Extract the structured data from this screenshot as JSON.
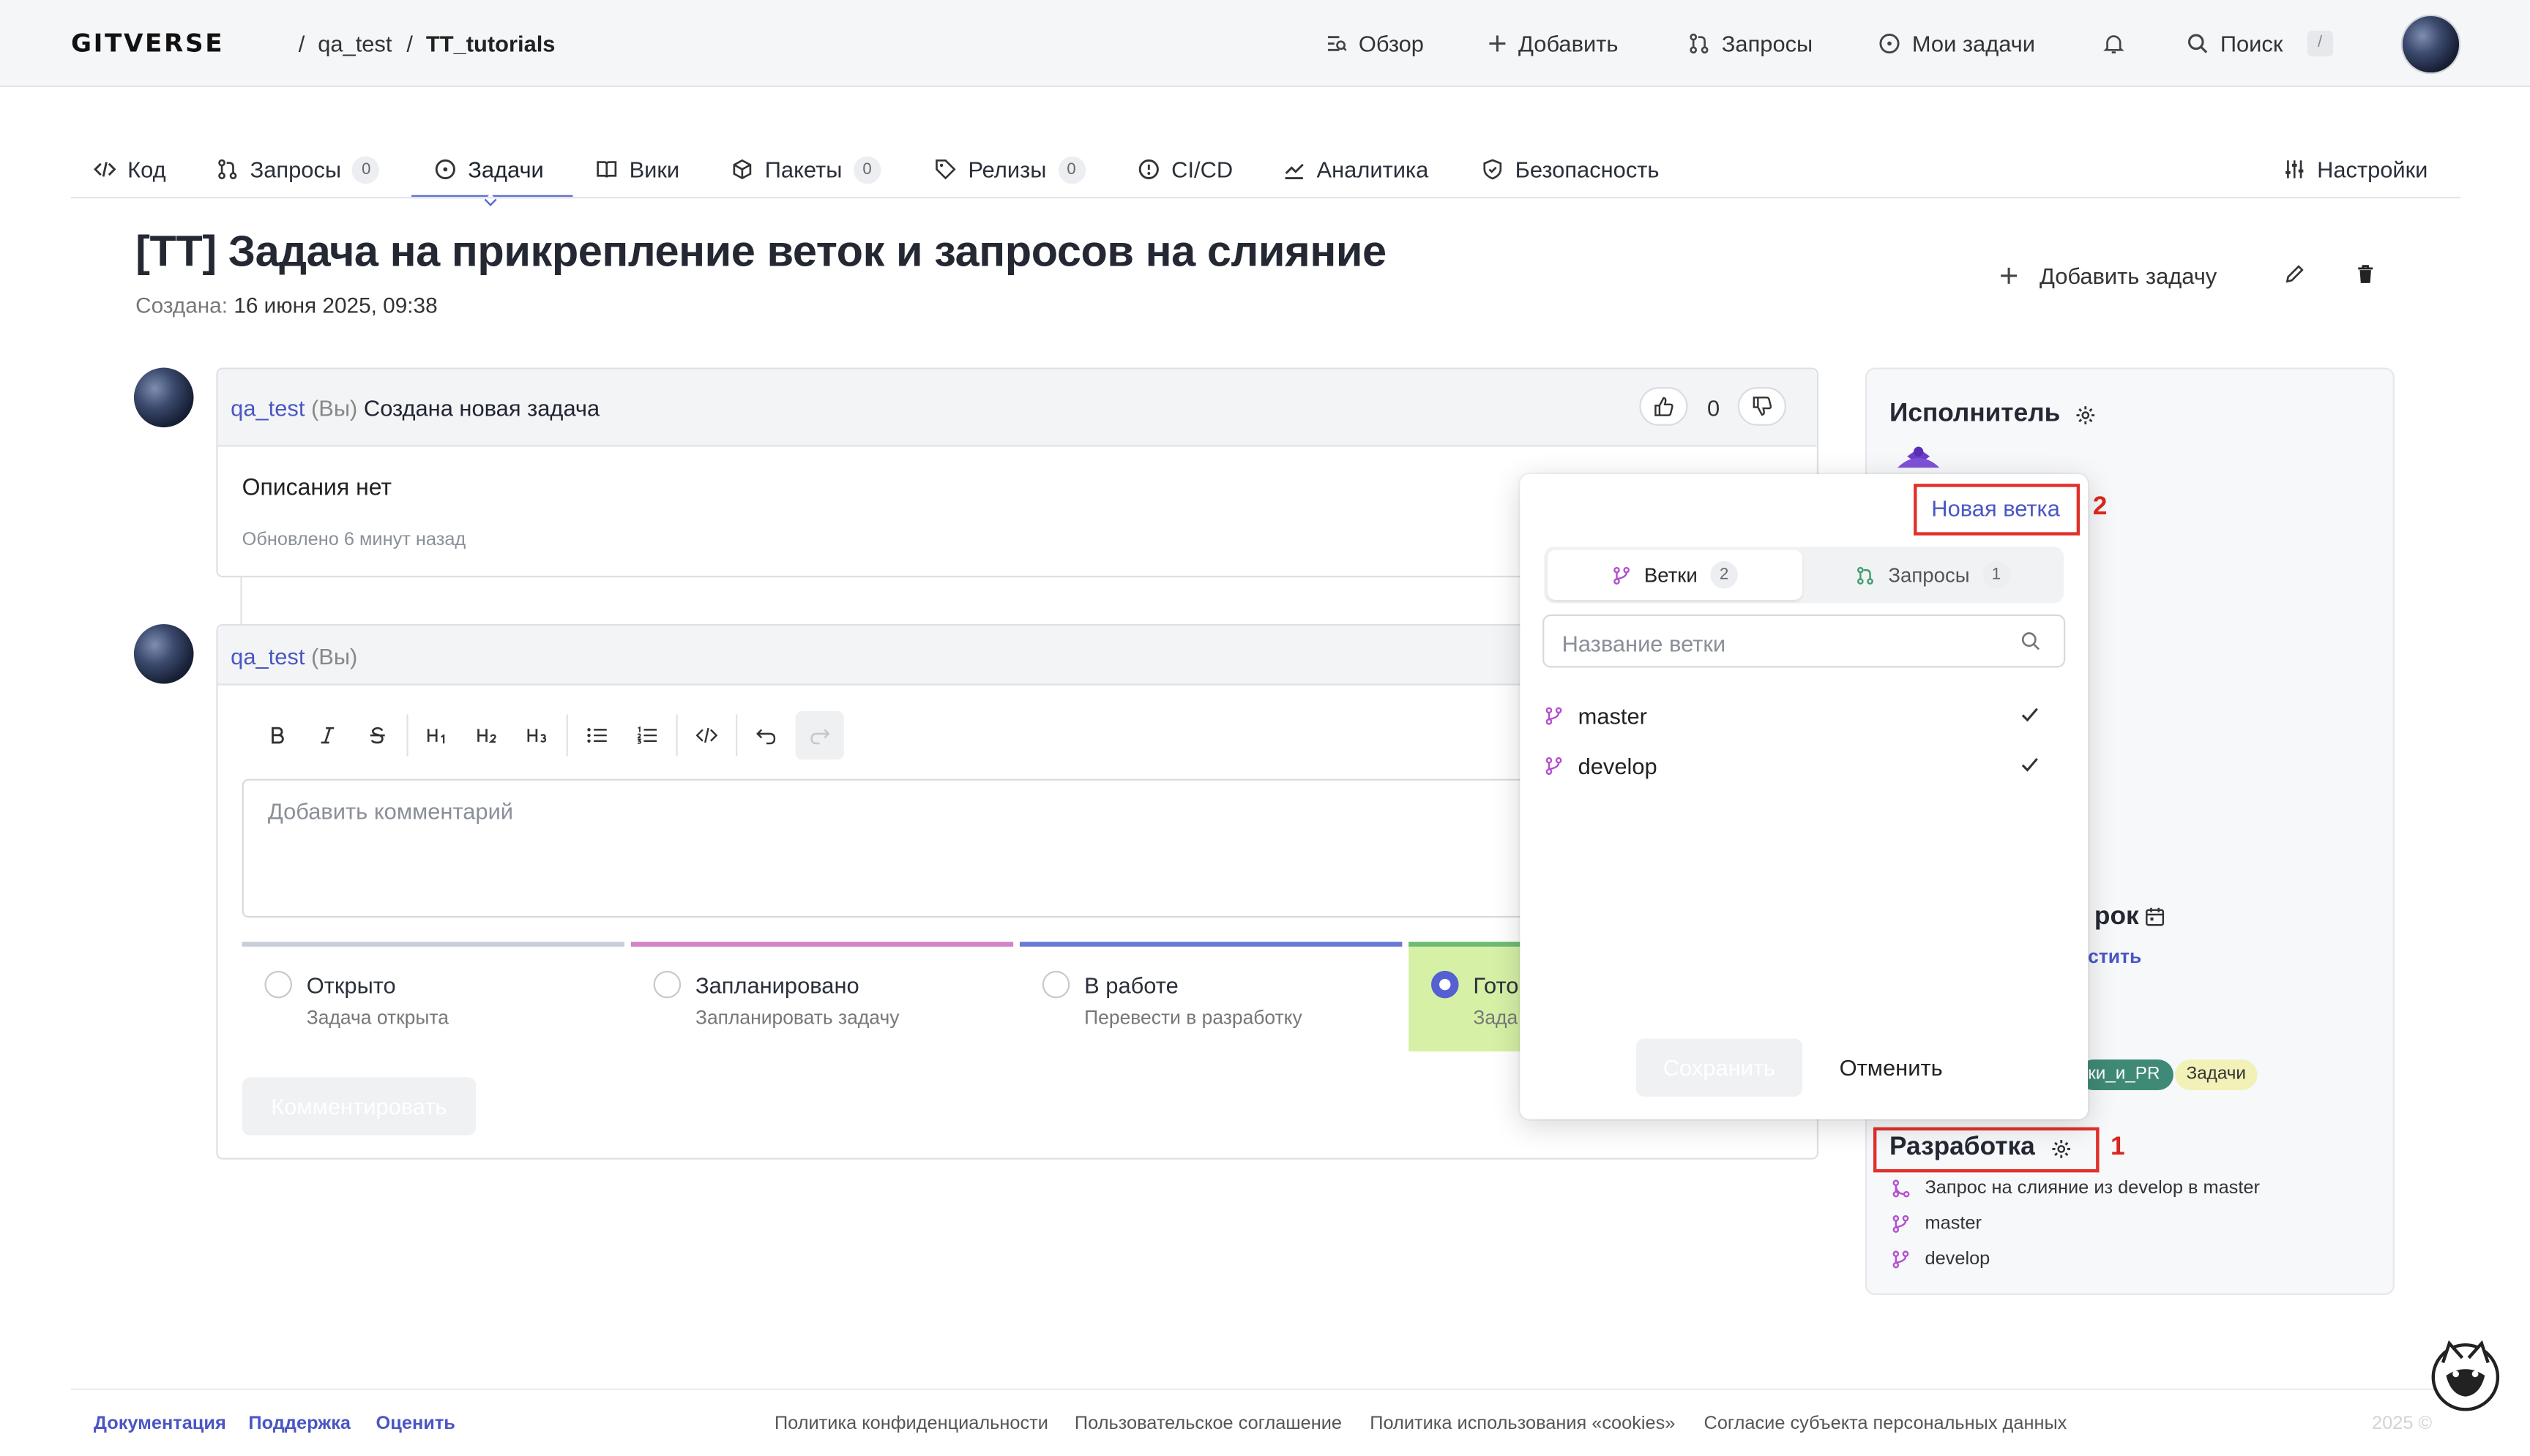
{
  "header": {
    "logo": "GITVERSE",
    "breadcrumb": [
      "qa_test",
      "TT_tutorials"
    ],
    "separator": "/",
    "nav": {
      "overview": "Обзор",
      "add": "Добавить",
      "requests": "Запросы",
      "my_tasks": "Мои задачи",
      "search": "Поиск",
      "search_kbd": "/"
    }
  },
  "tabs": [
    {
      "label": "Код",
      "icon": "code-icon"
    },
    {
      "label": "Запросы",
      "count": "0",
      "icon": "pull-request-icon"
    },
    {
      "label": "Задачи",
      "icon": "issue-icon",
      "active": true
    },
    {
      "label": "Вики",
      "icon": "book-icon"
    },
    {
      "label": "Пакеты",
      "count": "0",
      "icon": "package-icon"
    },
    {
      "label": "Релизы",
      "count": "0",
      "icon": "tag-icon"
    },
    {
      "label": "CI/CD",
      "icon": "pipeline-icon"
    },
    {
      "label": "Аналитика",
      "icon": "chart-icon"
    },
    {
      "label": "Безопасность",
      "icon": "shield-icon"
    },
    {
      "label": "Настройки",
      "icon": "sliders-icon"
    }
  ],
  "issue": {
    "title": "[TT] Задача на прикрепление веток и запросов на слияние",
    "created_label": "Создана:",
    "created_value": "16 июня 2025, 09:38",
    "add_task": "Добавить задачу"
  },
  "comment1": {
    "author": "qa_test",
    "you": "(Вы)",
    "action": "Создана новая задача",
    "body": "Описания нет",
    "updated": "Обновлено 6 минут назад",
    "reactions": "0"
  },
  "comment2": {
    "author": "qa_test",
    "you": "(Вы)",
    "placeholder": "Добавить комментарий",
    "submit": "Комментировать"
  },
  "statuses": [
    {
      "name": "Открыто",
      "desc": "Задача открыта",
      "color": "#c9cfd6"
    },
    {
      "name": "Запланировано",
      "desc": "Запланировать задачу",
      "color": "#d483c8"
    },
    {
      "name": "В работе",
      "desc": "Перевести в разработку",
      "color": "#6a78d8"
    },
    {
      "name": "Гото",
      "desc": "Зада",
      "color": "#6dbb75",
      "selected": true
    }
  ],
  "sidebar": {
    "assignee_title": "Исполнитель",
    "deadline_partial": "рок",
    "deadline_link_partial": "стить",
    "labels": [
      "ки_и_PR",
      "Задачи"
    ],
    "dev_title": "Разработка",
    "dev_items": [
      "Запрос на слияние из develop в master",
      "master",
      "develop"
    ],
    "marker": "1"
  },
  "popup": {
    "new_branch": "Новая ветка",
    "marker": "2",
    "tab_branches": "Ветки",
    "tab_branches_count": "2",
    "tab_requests": "Запросы",
    "tab_requests_count": "1",
    "search_placeholder": "Название ветки",
    "branches": [
      "master",
      "develop"
    ],
    "save": "Сохранить",
    "cancel": "Отменить"
  },
  "footer": {
    "left": [
      "Документация",
      "Поддержка",
      "Оценить"
    ],
    "center": [
      "Политика конфиденциальности",
      "Пользовательское соглашение",
      "Политика использования «cookies»",
      "Согласие субъекта персональных данных"
    ],
    "copyright": "2025 ©"
  },
  "colors": {
    "accent": "#4a56c4",
    "branch": "#b34fcf",
    "marker": "#e0312a",
    "done_bg": "#d6f0a6"
  }
}
